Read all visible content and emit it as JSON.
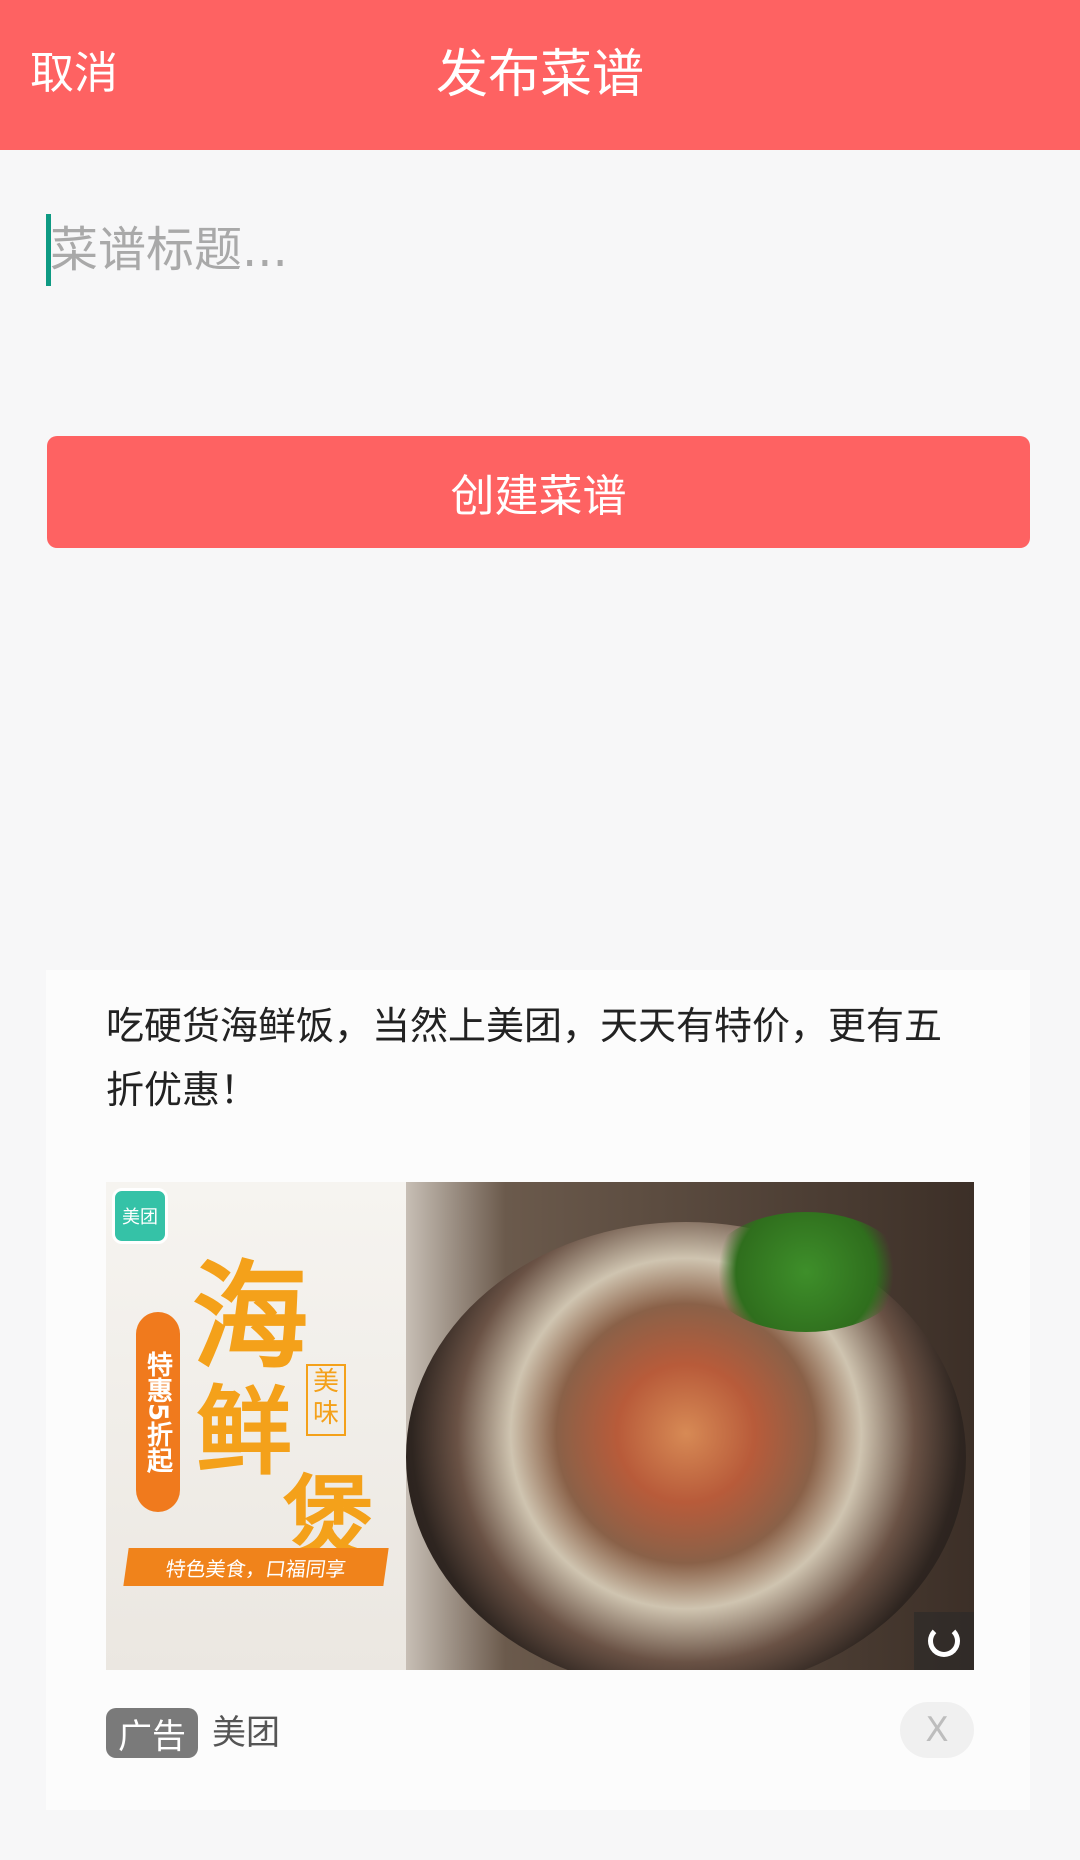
{
  "header": {
    "cancel_label": "取消",
    "title": "发布菜谱",
    "background_color": "#fe6262"
  },
  "form": {
    "title_placeholder": "菜谱标题...",
    "title_value": "",
    "create_button_label": "创建菜谱",
    "accent_color": "#fe6262"
  },
  "ad": {
    "text": "吃硬货海鲜饭，当然上美团，天天有特价，更有五折优惠！",
    "image": {
      "logo_text": "美团",
      "tag_text": "特惠5折起",
      "headline_1": "海",
      "headline_2": "鲜",
      "headline_3": "煲",
      "badge_text": "美味",
      "ribbon_text": "特色美食，口福同享",
      "reload_icon": "reload-icon"
    },
    "label": "广告",
    "brand": "美团",
    "close_label": "X"
  }
}
